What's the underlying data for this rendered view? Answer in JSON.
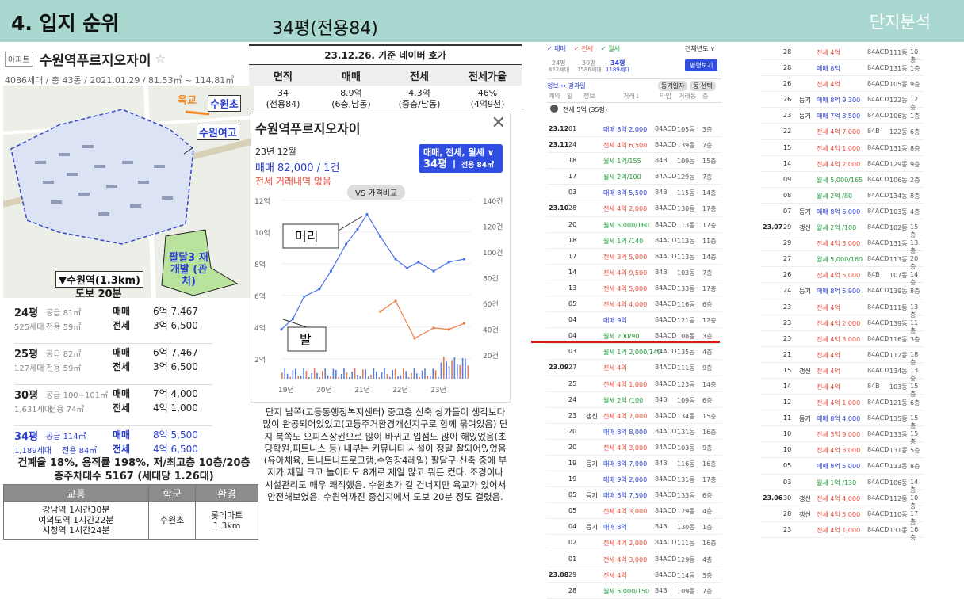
{
  "header": {
    "section": "4. 입지 순위",
    "subtitle": "34평(전용84)",
    "right": "단지분석"
  },
  "apt": {
    "tag": "아파트",
    "name": "수원역푸르지오자이",
    "star": "☆",
    "info": "4086세대 / 총 43동 / 2021.01.29 / 81.53㎡ ~ 114.81㎡"
  },
  "map": {
    "yukgyo": "육교",
    "suwoncho": "수원초",
    "yeogo": "수원여고",
    "station": "▼수원역(1.3km)",
    "walk": "도보 20분",
    "paldal": "팔달3 재개발 (관처)"
  },
  "types": [
    {
      "py": "24평",
      "count": "525세대",
      "supply": "공급 81㎡",
      "excl": "전용 59㎡",
      "l1": "매매",
      "v1": "6억 7,467",
      "l2": "전세",
      "v2": "3억 6,500"
    },
    {
      "py": "25평",
      "count": "127세대",
      "supply": "공급 82㎡",
      "excl": "전용 59㎡",
      "l1": "매매",
      "v1": "6억 7,467",
      "l2": "전세",
      "v2": "3억 6,500"
    },
    {
      "py": "30평",
      "count": "1,631세대",
      "supply": "공급 100~101㎡",
      "excl": "전용 74㎡",
      "l1": "매매",
      "v1": "7억 4,000",
      "l2": "전세",
      "v2": "4억 1,000"
    },
    {
      "py": "34평",
      "count": "1,189세대",
      "supply": "공급 114㎡",
      "excl": "전용 84㎡",
      "l1": "매매",
      "v1": "8억 5,500",
      "l2": "전세",
      "v2": "4억 6,500"
    }
  ],
  "stats": {
    "line1": "건폐율 18%, 용적률 198%, 저/최고층 10층/20층",
    "line2": "총주차대수 5167 (세대당 1.26대)"
  },
  "school": {
    "h1": "교통",
    "h2": "학군",
    "h3": "환경",
    "c1a": "강남역 1시간30분",
    "c1b": "여의도역 1시간22분",
    "c1c": "시청역 1시간24분",
    "c2": "수원초",
    "c3a": "롯데마트",
    "c3b": "1.3km"
  },
  "mid": {
    "caption": "23.12.26. 기준 네이버 호가",
    "h1": "면적",
    "h2": "매매",
    "h3": "전세",
    "h4": "전세가율",
    "a1": "34",
    "a2": "(전용84)",
    "b1": "8.9억",
    "b2": "(6층,남동)",
    "c1": "4.3억",
    "c2": "(중층/남동)",
    "d1": "46%",
    "d2": "(4억9천)"
  },
  "pop": {
    "title": "수원역푸르지오자이",
    "period": "23년 12월",
    "price": "매매 82,000 / 1건",
    "none": "전세 거래내역 없음",
    "sel1": "매매, 전세, 월세 ∨",
    "sel2": "34평",
    "sel3": "전용 84㎡",
    "vs": "VS 가격비교",
    "head": "머리",
    "foot": "발",
    "close": "✕"
  },
  "chart_data": {
    "type": "line",
    "x": [
      "19년",
      "20년",
      "21년",
      "22년",
      "23년"
    ],
    "yleft": [
      "12억",
      "10억",
      "8억",
      "6억",
      "4억",
      "2억"
    ],
    "yright": [
      "140건",
      "120건",
      "100건",
      "80건",
      "60건",
      "40건",
      "20건"
    ],
    "sale": [
      [
        0,
        4.3
      ],
      [
        0.3,
        5.0
      ],
      [
        0.6,
        6.5
      ],
      [
        1.0,
        7.0
      ],
      [
        1.3,
        8.2
      ],
      [
        1.7,
        10.0
      ],
      [
        2.0,
        11.0
      ],
      [
        2.25,
        12.0
      ],
      [
        2.6,
        10.5
      ],
      [
        3.0,
        9.0
      ],
      [
        3.3,
        8.4
      ],
      [
        3.6,
        8.8
      ],
      [
        4.0,
        8.2
      ],
      [
        4.4,
        8.8
      ],
      [
        4.8,
        9.0
      ]
    ],
    "jeonse": [
      [
        2.6,
        5.5
      ],
      [
        3.0,
        6.2
      ],
      [
        3.5,
        3.7
      ],
      [
        4.0,
        4.4
      ],
      [
        4.4,
        4.3
      ],
      [
        4.8,
        4.7
      ]
    ]
  },
  "desc": "단지 남쪽(고등동행정복지센터) 중고층 신축 상가들이 생각보다 많이 완공되어있었고(고등주거환경개선지구로 함께 묶여있음) 단지 북쪽도 오피스상권으로 많이 바뀌고 입점도 많이 해있었음(초딩학원,피트니스 등) 내부는 커뮤니티 시설이 정말 잘되어있었음(유아체육, 트니트니프로그램,수영장4레일) 팔달구 신축 중에 부지가 제일 크고 놀이터도 8개로 제일 많고 뭐든 컸다. 조경이나 시설관리도 매우 쾌적했음. 수원초가 길 건너지만 육교가 있어서 안전해보였음. 수원역까진 중심지에서 도보 20분 정도 걸렸음.",
  "ttop": {
    "f1": "✓ 매매",
    "f2": "✓ 전세",
    "f3": "✓ 월세",
    "year": "전체년도 ∨",
    "t1": "24평",
    "t2": "30평",
    "t3": "34평",
    "c1": "652세대",
    "c2": "1586세대",
    "c3": "1189세대",
    "btn": "평형보기",
    "info": "정보 ↔ 경과일",
    "b1": "동기일자",
    "b2": "동 선택",
    "hd1": "계약",
    "hd2": "일",
    "hd3": "정보",
    "hd4": "거래↓",
    "hd5": "타입",
    "hd6": "거래동",
    "hd7": "층",
    "note": "전세 5억 (35평)"
  },
  "hist1": [
    {
      "d": "23.12",
      "day": "01",
      "m": "",
      "p": "매매 8억 2,000",
      "c": "m",
      "t": "84ACD",
      "dg": "105동",
      "fl": "3층"
    },
    {
      "d": "23.11",
      "day": "24",
      "m": "",
      "p": "전세 4억 6,500",
      "c": "j",
      "t": "84ACD",
      "dg": "139동",
      "fl": "7층"
    },
    {
      "d": "",
      "day": "18",
      "m": "",
      "p": "월세 1억/155",
      "c": "w",
      "t": "84B",
      "dg": "109동",
      "fl": "15층"
    },
    {
      "d": "",
      "day": "17",
      "m": "",
      "p": "월세 2억/100",
      "c": "w",
      "t": "84ACD",
      "dg": "129동",
      "fl": "7층"
    },
    {
      "d": "",
      "day": "03",
      "m": "",
      "p": "매매 8억 5,500",
      "c": "m",
      "t": "84B",
      "dg": "115동",
      "fl": "14층"
    },
    {
      "d": "23.10",
      "day": "28",
      "m": "",
      "p": "전세 4억 2,000",
      "c": "j",
      "t": "84ACD",
      "dg": "130동",
      "fl": "17층"
    },
    {
      "d": "",
      "day": "20",
      "m": "",
      "p": "월세 5,000/160",
      "c": "w",
      "t": "84ACD",
      "dg": "113동",
      "fl": "17층"
    },
    {
      "d": "",
      "day": "18",
      "m": "",
      "p": "월세 1억 /140",
      "c": "w",
      "t": "84ACD",
      "dg": "113동",
      "fl": "11층"
    },
    {
      "d": "",
      "day": "17",
      "m": "",
      "p": "전세 3억 5,000",
      "c": "j",
      "t": "84ACD",
      "dg": "113동",
      "fl": "14층"
    },
    {
      "d": "",
      "day": "14",
      "m": "",
      "p": "전세 4억 9,500",
      "c": "j",
      "t": "84B",
      "dg": "103동",
      "fl": "7층"
    },
    {
      "d": "",
      "day": "13",
      "m": "",
      "p": "전세 4억 5,000",
      "c": "j",
      "t": "84ACD",
      "dg": "133동",
      "fl": "17층"
    },
    {
      "d": "",
      "day": "05",
      "m": "",
      "p": "전세 4억 4,000",
      "c": "j",
      "t": "84ACD",
      "dg": "116동",
      "fl": "6층"
    },
    {
      "d": "",
      "day": "04",
      "m": "",
      "p": "매매 9억",
      "c": "m",
      "t": "84ACD",
      "dg": "121동",
      "fl": "12층"
    },
    {
      "d": "",
      "day": "04",
      "m": "",
      "p": "월세 200/90",
      "c": "w",
      "t": "84ACD",
      "dg": "108동",
      "fl": "3층"
    },
    {
      "d": "",
      "day": "03",
      "m": "",
      "p": "월세 1억 2,000/140",
      "c": "w",
      "t": "84ACD",
      "dg": "135동",
      "fl": "4층"
    },
    {
      "d": "23.09",
      "day": "27",
      "m": "",
      "p": "전세 4억",
      "c": "j",
      "t": "84ACD",
      "dg": "111동",
      "fl": "9층"
    },
    {
      "d": "",
      "day": "25",
      "m": "",
      "p": "전세 4억 1,000",
      "c": "j",
      "t": "84ACD",
      "dg": "123동",
      "fl": "14층"
    },
    {
      "d": "",
      "day": "24",
      "m": "",
      "p": "월세 2억 /100",
      "c": "w",
      "t": "84B",
      "dg": "109동",
      "fl": "6층"
    },
    {
      "d": "",
      "day": "23",
      "m": "갱신",
      "p": "전세 4억 7,000",
      "c": "j",
      "t": "84ACD",
      "dg": "134동",
      "fl": "15층"
    },
    {
      "d": "",
      "day": "20",
      "m": "",
      "p": "매매 8억 8,000",
      "c": "m",
      "t": "84ACD",
      "dg": "131동",
      "fl": "16층"
    },
    {
      "d": "",
      "day": "20",
      "m": "",
      "p": "전세 4억 3,000",
      "c": "j",
      "t": "84ACD",
      "dg": "103동",
      "fl": "9층"
    },
    {
      "d": "",
      "day": "19",
      "m": "등기",
      "p": "매매 8억 7,000",
      "c": "m",
      "t": "84B",
      "dg": "116동",
      "fl": "16층"
    },
    {
      "d": "",
      "day": "19",
      "m": "",
      "p": "매매 9억 2,000",
      "c": "m",
      "t": "84ACD",
      "dg": "131동",
      "fl": "17층"
    },
    {
      "d": "",
      "day": "05",
      "m": "등기",
      "p": "매매 8억 7,500",
      "c": "m",
      "t": "84ACD",
      "dg": "133동",
      "fl": "6층"
    },
    {
      "d": "",
      "day": "05",
      "m": "",
      "p": "전세 4억 3,000",
      "c": "j",
      "t": "84ACD",
      "dg": "129동",
      "fl": "4층"
    },
    {
      "d": "",
      "day": "04",
      "m": "등기",
      "p": "매매 8억",
      "c": "m",
      "t": "84B",
      "dg": "130동",
      "fl": "1층"
    },
    {
      "d": "",
      "day": "02",
      "m": "",
      "p": "전세 4억 2,000",
      "c": "j",
      "t": "84ACD",
      "dg": "111동",
      "fl": "16층"
    },
    {
      "d": "",
      "day": "01",
      "m": "",
      "p": "전세 4억 3,000",
      "c": "j",
      "t": "84ACD",
      "dg": "129동",
      "fl": "4층"
    },
    {
      "d": "23.08",
      "day": "29",
      "m": "",
      "p": "전세 4억",
      "c": "j",
      "t": "84ACD",
      "dg": "114동",
      "fl": "5층"
    },
    {
      "d": "",
      "day": "28",
      "m": "",
      "p": "월세 5,000/150",
      "c": "w",
      "t": "84B",
      "dg": "109동",
      "fl": "7층"
    }
  ],
  "hist2": [
    {
      "d": "",
      "day": "28",
      "m": "",
      "p": "전세 4억",
      "c": "j",
      "t": "84ACD",
      "dg": "111동",
      "fl": "10층"
    },
    {
      "d": "",
      "day": "28",
      "m": "",
      "p": "매매 8억",
      "c": "m",
      "t": "84ACD",
      "dg": "131동",
      "fl": "1층"
    },
    {
      "d": "",
      "day": "26",
      "m": "",
      "p": "전세 4억",
      "c": "j",
      "t": "84ACD",
      "dg": "105동",
      "fl": "9층"
    },
    {
      "d": "",
      "day": "26",
      "m": "등기",
      "p": "매매 8억 9,300",
      "c": "m",
      "t": "84ACD",
      "dg": "122동",
      "fl": "12층"
    },
    {
      "d": "",
      "day": "23",
      "m": "등기",
      "p": "매매 7억 8,500",
      "c": "m",
      "t": "84ACD",
      "dg": "106동",
      "fl": "1층"
    },
    {
      "d": "",
      "day": "22",
      "m": "",
      "p": "전세 4억 7,000",
      "c": "j",
      "t": "84B",
      "dg": "122동",
      "fl": "6층"
    },
    {
      "d": "",
      "day": "15",
      "m": "",
      "p": "전세 4억 1,000",
      "c": "j",
      "t": "84ACD",
      "dg": "131동",
      "fl": "8층"
    },
    {
      "d": "",
      "day": "14",
      "m": "",
      "p": "전세 4억 2,000",
      "c": "j",
      "t": "84ACD",
      "dg": "129동",
      "fl": "9층"
    },
    {
      "d": "",
      "day": "09",
      "m": "",
      "p": "월세 5,000/165",
      "c": "w",
      "t": "84ACD",
      "dg": "106동",
      "fl": "2층"
    },
    {
      "d": "",
      "day": "08",
      "m": "",
      "p": "월세 2억 /80",
      "c": "w",
      "t": "84ACD",
      "dg": "134동",
      "fl": "8층"
    },
    {
      "d": "",
      "day": "07",
      "m": "등기",
      "p": "매매 8억 6,000",
      "c": "m",
      "t": "84ACD",
      "dg": "103동",
      "fl": "4층"
    },
    {
      "d": "23.07",
      "day": "29",
      "m": "갱신",
      "p": "월세 2억 /100",
      "c": "w",
      "t": "84ACD",
      "dg": "102동",
      "fl": "15층"
    },
    {
      "d": "",
      "day": "29",
      "m": "",
      "p": "전세 4억 3,000",
      "c": "j",
      "t": "84ACD",
      "dg": "131동",
      "fl": "13층"
    },
    {
      "d": "",
      "day": "27",
      "m": "",
      "p": "월세 5,000/160",
      "c": "w",
      "t": "84ACD",
      "dg": "113동",
      "fl": "20층"
    },
    {
      "d": "",
      "day": "26",
      "m": "",
      "p": "전세 4억 5,000",
      "c": "j",
      "t": "84B",
      "dg": "107동",
      "fl": "14층"
    },
    {
      "d": "",
      "day": "24",
      "m": "등기",
      "p": "매매 8억 5,900",
      "c": "m",
      "t": "84ACD",
      "dg": "139동",
      "fl": "8층"
    },
    {
      "d": "",
      "day": "23",
      "m": "",
      "p": "전세 4억",
      "c": "j",
      "t": "84ACD",
      "dg": "111동",
      "fl": "13층"
    },
    {
      "d": "",
      "day": "23",
      "m": "",
      "p": "전세 4억 2,000",
      "c": "j",
      "t": "84ACD",
      "dg": "139동",
      "fl": "11층"
    },
    {
      "d": "",
      "day": "23",
      "m": "",
      "p": "전세 4억 3,000",
      "c": "j",
      "t": "84ACD",
      "dg": "116동",
      "fl": "3층"
    },
    {
      "d": "",
      "day": "21",
      "m": "",
      "p": "전세 4억",
      "c": "j",
      "t": "84ACD",
      "dg": "112동",
      "fl": "18층"
    },
    {
      "d": "",
      "day": "15",
      "m": "갱신",
      "p": "전세 4억",
      "c": "j",
      "t": "84ACD",
      "dg": "134동",
      "fl": "13층"
    },
    {
      "d": "",
      "day": "14",
      "m": "",
      "p": "전세 4억",
      "c": "j",
      "t": "84B",
      "dg": "103동",
      "fl": "15층"
    },
    {
      "d": "",
      "day": "12",
      "m": "",
      "p": "전세 4억 1,000",
      "c": "j",
      "t": "84ACD",
      "dg": "121동",
      "fl": "6층"
    },
    {
      "d": "",
      "day": "11",
      "m": "등기",
      "p": "매매 8억 4,000",
      "c": "m",
      "t": "84ACD",
      "dg": "135동",
      "fl": "15층"
    },
    {
      "d": "",
      "day": "10",
      "m": "",
      "p": "전세 3억 9,000",
      "c": "j",
      "t": "84ACD",
      "dg": "133동",
      "fl": "15층"
    },
    {
      "d": "",
      "day": "10",
      "m": "",
      "p": "전세 4억 3,000",
      "c": "j",
      "t": "84ACD",
      "dg": "131동",
      "fl": "5층"
    },
    {
      "d": "",
      "day": "05",
      "m": "",
      "p": "매매 8억 5,000",
      "c": "m",
      "t": "84ACD",
      "dg": "133동",
      "fl": "8층"
    },
    {
      "d": "",
      "day": "03",
      "m": "",
      "p": "월세 1억 /130",
      "c": "w",
      "t": "84ACD",
      "dg": "106동",
      "fl": "14층"
    },
    {
      "d": "23.06",
      "day": "30",
      "m": "갱신",
      "p": "전세 4억 4,000",
      "c": "j",
      "t": "84ACD",
      "dg": "112동",
      "fl": "10층"
    },
    {
      "d": "",
      "day": "28",
      "m": "갱신",
      "p": "전세 4억 5,000",
      "c": "j",
      "t": "84ACD",
      "dg": "110동",
      "fl": "17층"
    },
    {
      "d": "",
      "day": "23",
      "m": "",
      "p": "전세 4억 1,000",
      "c": "j",
      "t": "84ACD",
      "dg": "131동",
      "fl": "16층"
    }
  ]
}
